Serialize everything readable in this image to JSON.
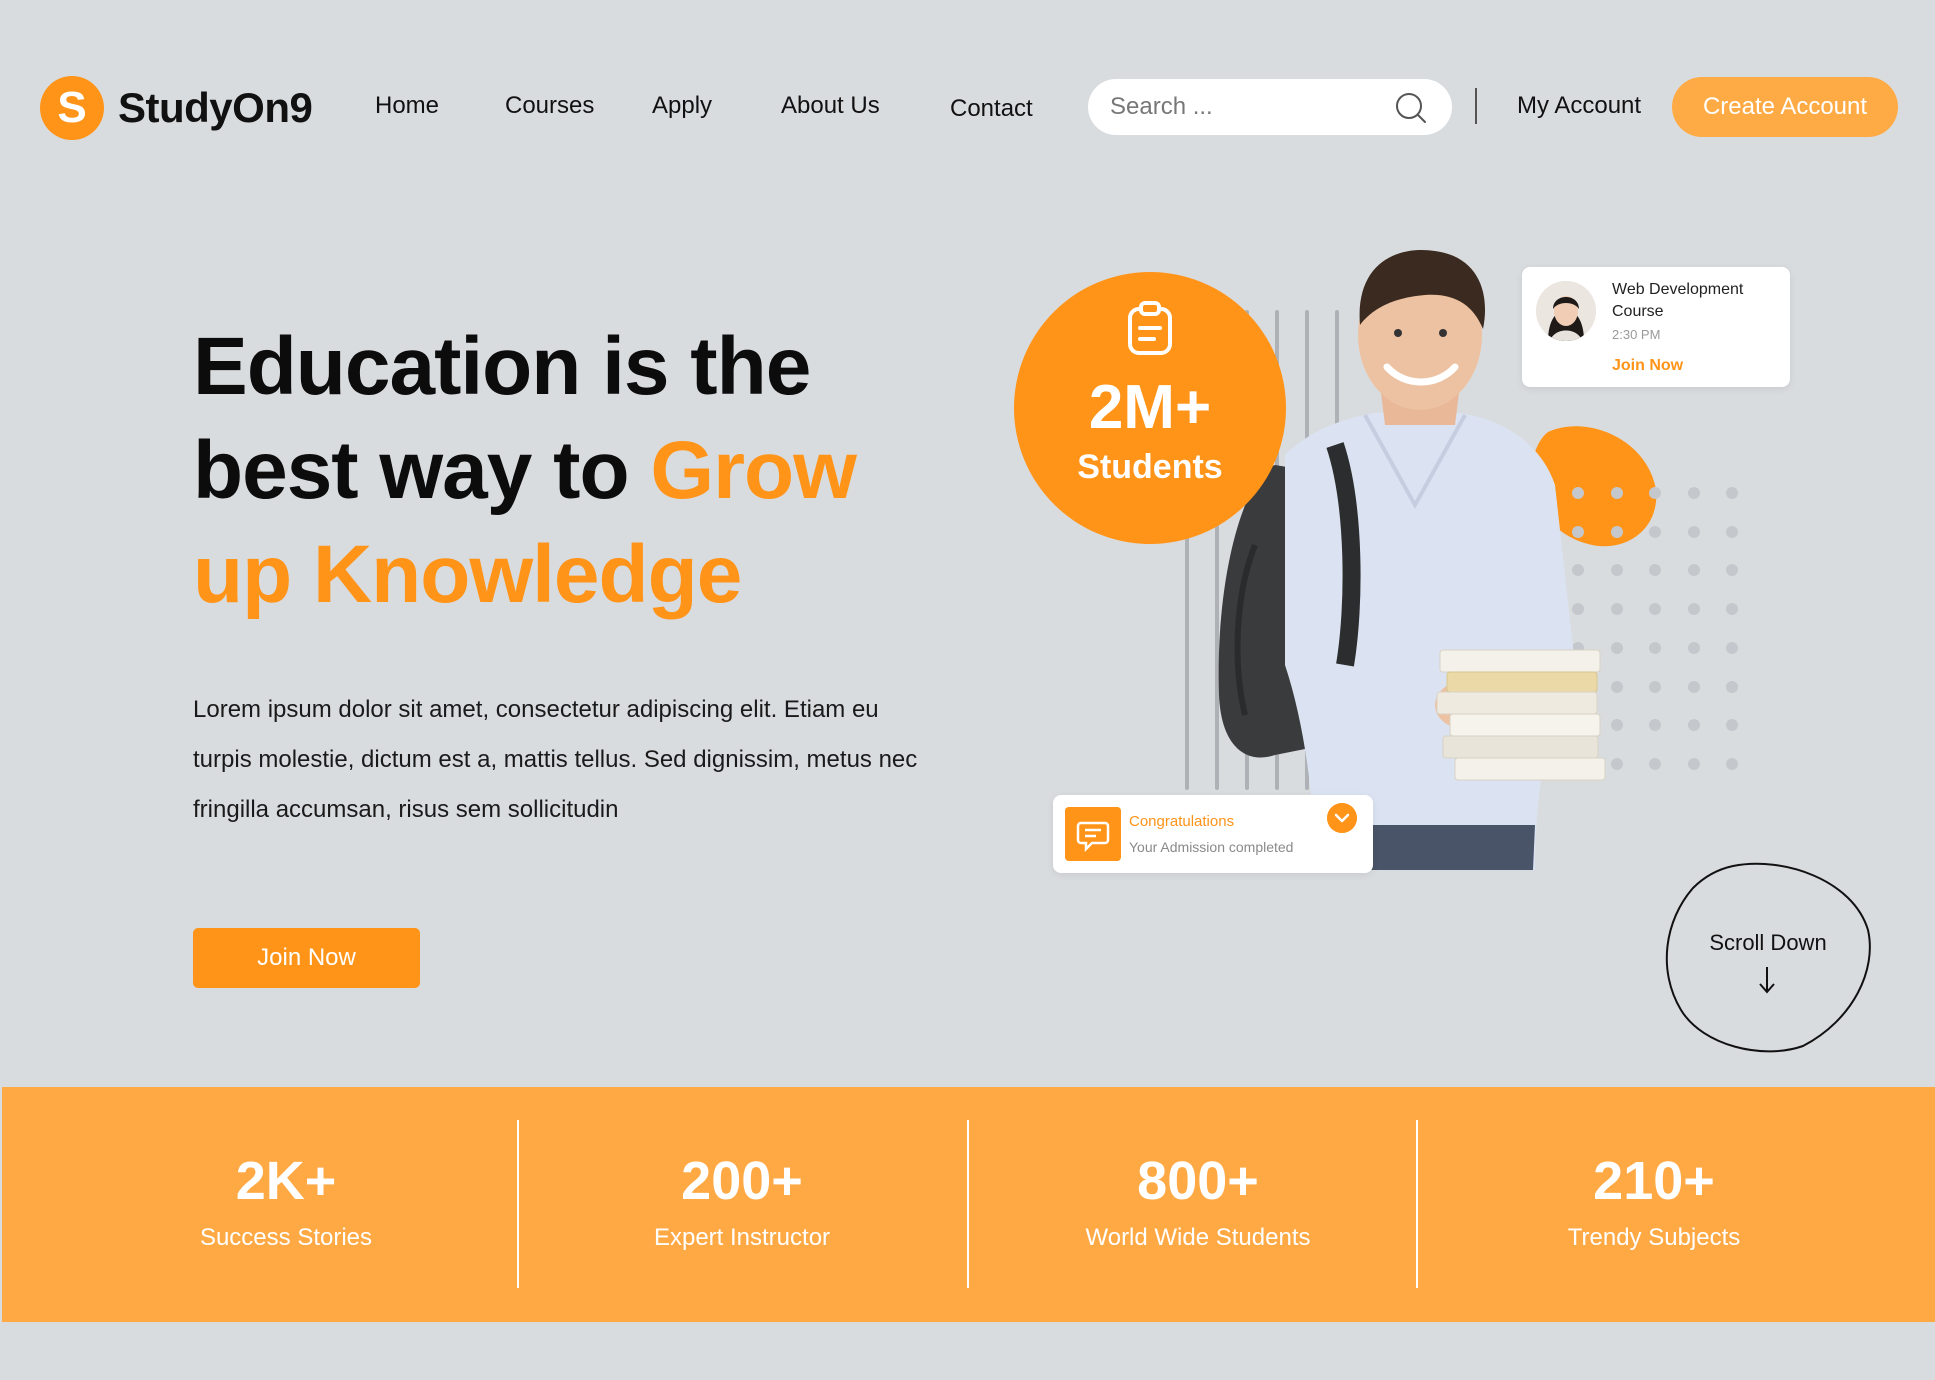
{
  "brand": {
    "logo_letter": "S",
    "name": "StudyOn9"
  },
  "nav": {
    "links": [
      "Home",
      "Courses",
      "Apply",
      "About Us",
      "Contact"
    ],
    "search_placeholder": "Search ...",
    "my_account": "My Account",
    "create_account": "Create Account"
  },
  "hero": {
    "title_line1": "Education is the",
    "title_line2_plain": "best way to ",
    "title_line2_accent": "Grow",
    "title_line3_accent": "up Knowledge",
    "description": "Lorem ipsum dolor sit amet, consectetur adipiscing elit. Etiam eu turpis molestie, dictum est a, mattis tellus. Sed dignissim, metus nec fringilla accumsan, risus sem sollicitudin",
    "join_button": "Join Now"
  },
  "students_badge": {
    "count": "2M+",
    "label": "Students",
    "icon": "clipboard-icon"
  },
  "course_card": {
    "title": "Web Development Course",
    "time": "2:30 PM",
    "action": "Join Now"
  },
  "congrats_card": {
    "title": "Congratulations",
    "subtitle": "Your Admission completed",
    "icon": "chat-icon",
    "check_icon": "chevron-down-icon"
  },
  "scroll_down": {
    "label": "Scroll Down",
    "icon": "arrow-down-icon"
  },
  "stats": [
    {
      "value": "2K+",
      "label": "Success Stories"
    },
    {
      "value": "200+",
      "label": "Expert Instructor"
    },
    {
      "value": "800+",
      "label": "World Wide Students"
    },
    {
      "value": "210+",
      "label": "Trendy Subjects"
    }
  ],
  "colors": {
    "accent": "#ff9419",
    "accent_light": "#ffa944",
    "background": "#d9dcdf"
  }
}
